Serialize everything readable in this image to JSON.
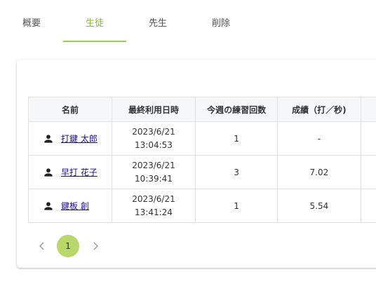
{
  "tabs": [
    {
      "label": "概要"
    },
    {
      "label": "生徒"
    },
    {
      "label": "先生"
    },
    {
      "label": "削除"
    }
  ],
  "table": {
    "headers": [
      "名前",
      "最終利用日時",
      "今週の練習回数",
      "成績（打／秒)"
    ],
    "rows": [
      {
        "name": "打鍵 太郎",
        "date": "2023/6/21",
        "time": "13:04:53",
        "count": "1",
        "score": "-"
      },
      {
        "name": "早打 花子",
        "date": "2023/6/21",
        "time": "10:39:41",
        "count": "3",
        "score": "7.02"
      },
      {
        "name": "鍵板 創",
        "date": "2023/6/21",
        "time": "13:41:24",
        "count": "1",
        "score": "5.54"
      }
    ]
  },
  "pagination": {
    "prev_icon": "chevron-left-icon",
    "next_icon": "chevron-right-icon",
    "current_page": "1"
  },
  "colors": {
    "accent": "#9ccc54",
    "active_tab_text": "#8bb83a",
    "page_active_bg": "#b8d86a",
    "link": "#1a0dab"
  }
}
